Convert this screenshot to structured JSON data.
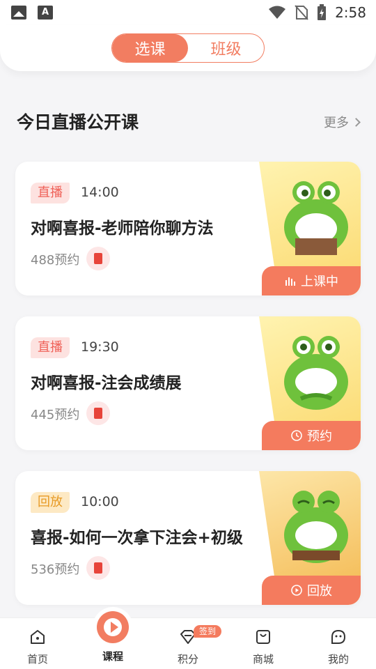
{
  "status_bar": {
    "time": "2:58"
  },
  "segment": {
    "options": [
      "选课",
      "班级"
    ],
    "selected": "选课"
  },
  "section": {
    "title": "今日直播公开课",
    "more_label": "更多"
  },
  "courses": [
    {
      "tag": "直播",
      "time": "14:00",
      "title": "对啊喜报-老师陪你聊方法",
      "reservations": "488预约",
      "action": "上课中",
      "action_icon": "bars-icon"
    },
    {
      "tag": "直播",
      "time": "19:30",
      "title": "对啊喜报-注会成绩展",
      "reservations": "445预约",
      "action": "预约",
      "action_icon": "clock-icon"
    },
    {
      "tag": "回放",
      "time": "10:00",
      "title": "喜报-如何一次拿下注会+初级",
      "reservations": "536预约",
      "action": "回放",
      "action_icon": "play-icon"
    }
  ],
  "bottom_nav": {
    "items": [
      {
        "label": "首页",
        "icon": "home-icon"
      },
      {
        "label": "课程",
        "icon": "play-icon",
        "active": true
      },
      {
        "label": "积分",
        "icon": "diamond-icon",
        "badge": "签到"
      },
      {
        "label": "商城",
        "icon": "bag-icon"
      },
      {
        "label": "我的",
        "icon": "face-icon"
      }
    ]
  },
  "colors": {
    "accent": "#f27d61",
    "live_tag": "#ef6158",
    "replay_tag": "#e79a24"
  }
}
